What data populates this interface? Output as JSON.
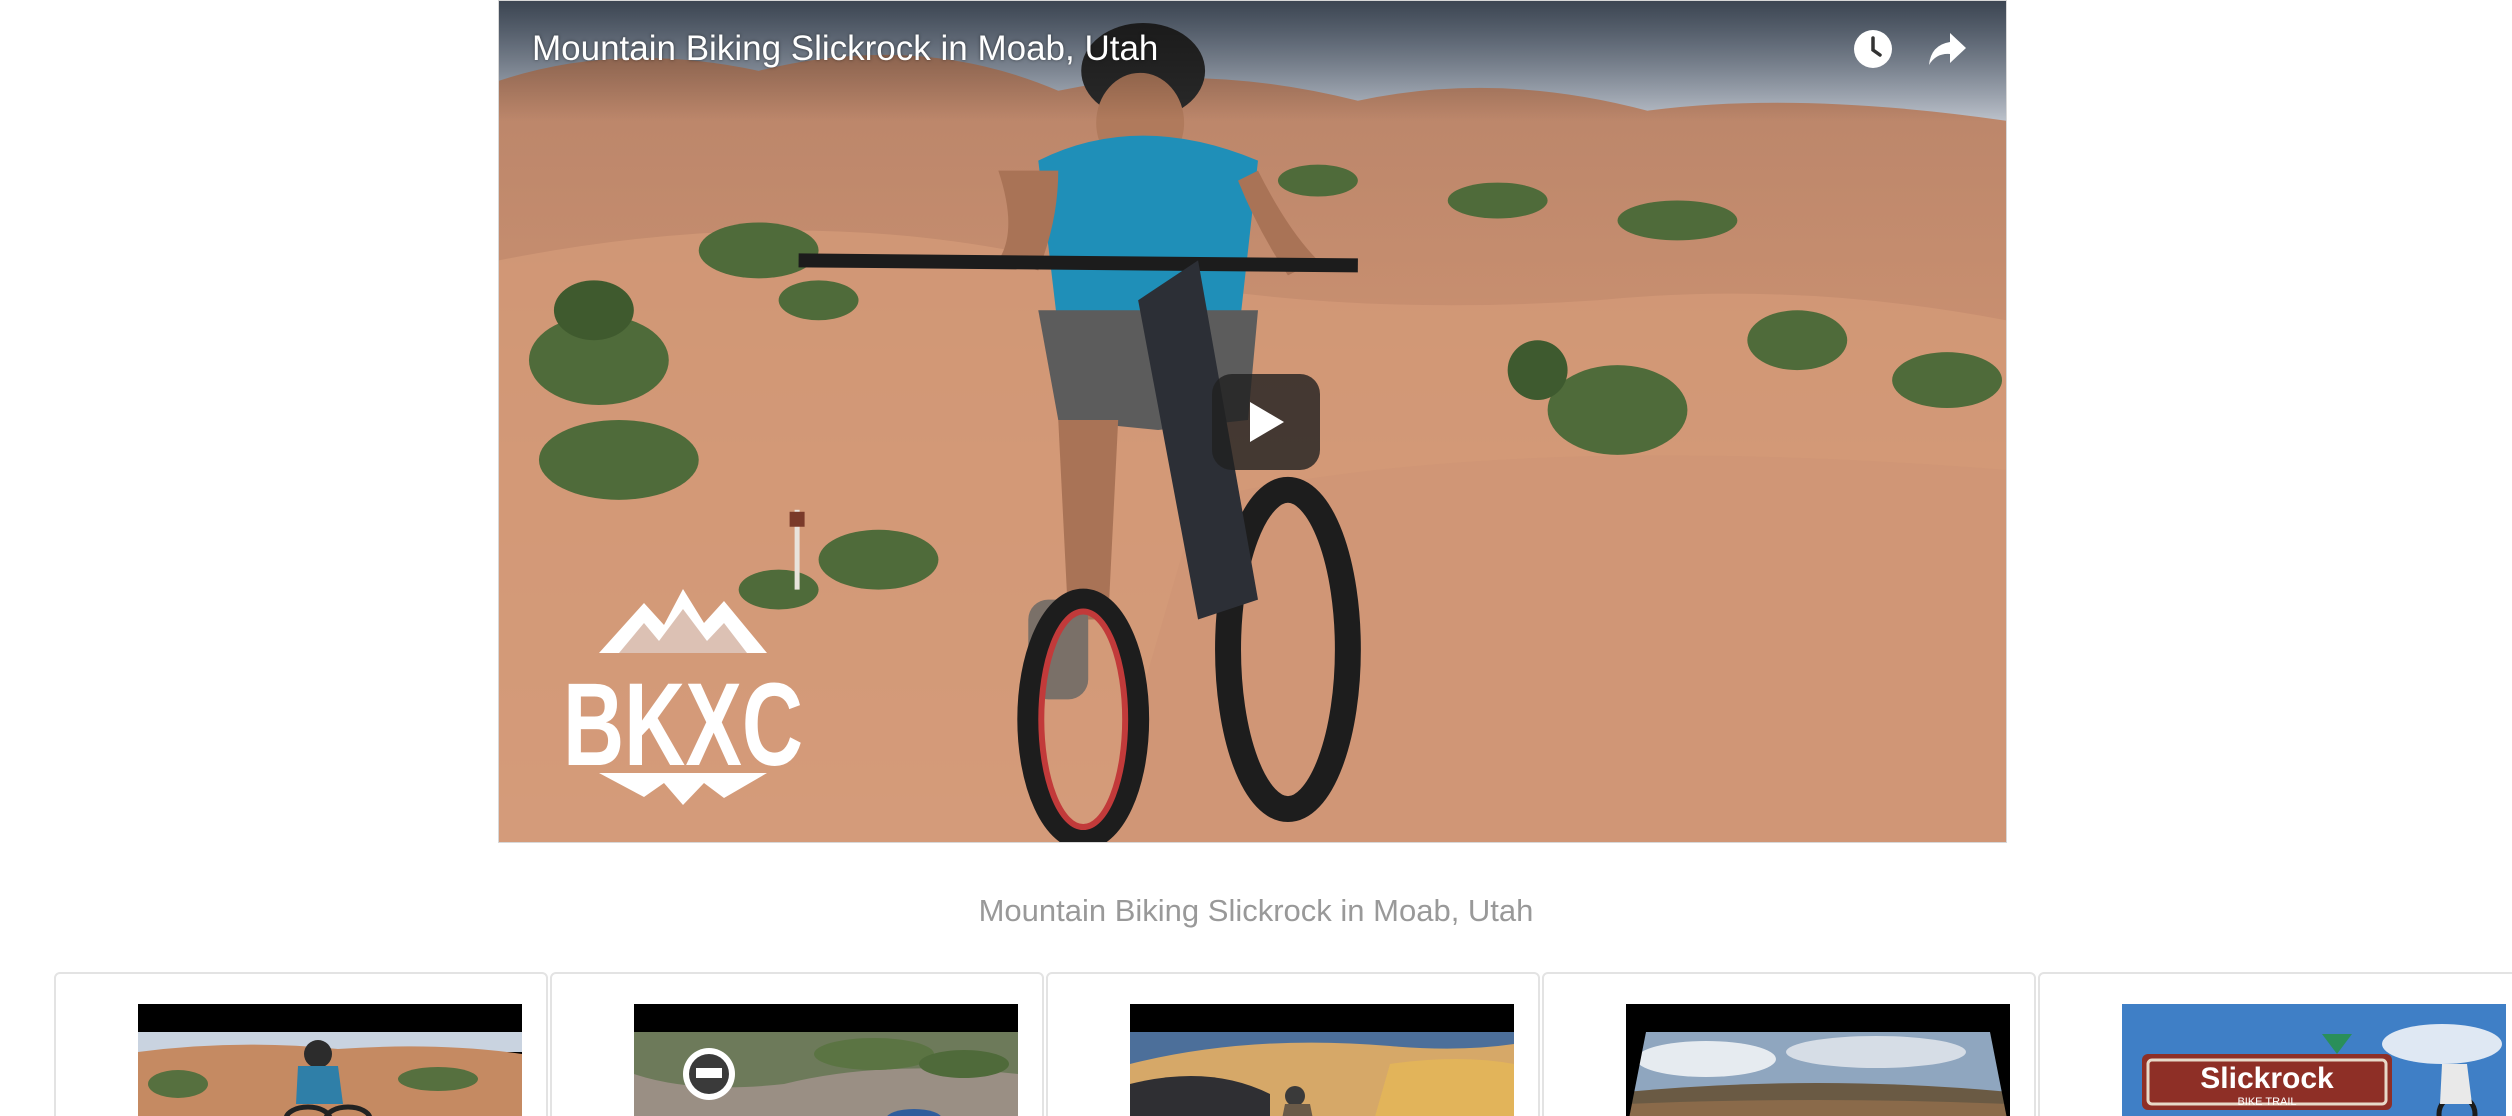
{
  "player": {
    "title": "Mountain Biking Slickrock in Moab, Utah",
    "logo_text": "BKXC",
    "icons": [
      "clock-icon",
      "share-arrow-icon",
      "play-icon"
    ]
  },
  "caption": "Mountain Biking Slickrock in Moab, Utah",
  "thumbnails": [
    {
      "icon": "thumbnail-rider-desert"
    },
    {
      "icon": "thumbnail-rider-trail"
    },
    {
      "icon": "thumbnail-rider-slickrock"
    },
    {
      "icon": "thumbnail-panorama"
    },
    {
      "icon": "thumbnail-trail-sign",
      "sign_text": "Slickrock",
      "sign_subtext": "BIKE TRAIL"
    }
  ],
  "colors": {
    "caption_text": "#999999",
    "card_border": "#e3e3e3",
    "play_button_bg": "#212121",
    "sandstone": "#c98a65"
  }
}
